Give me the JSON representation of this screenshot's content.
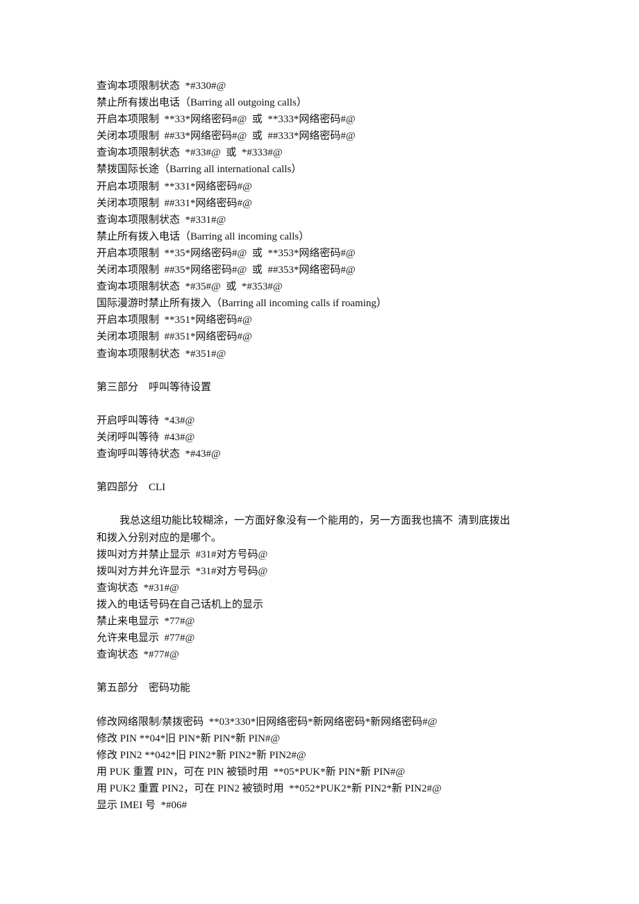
{
  "lines": [
    {
      "text": "查询本项限制状态  *#330#@"
    },
    {
      "text": "禁止所有拨出电话（Barring all outgoing calls）"
    },
    {
      "text": "开启本项限制  **33*网络密码#@  或  **333*网络密码#@"
    },
    {
      "text": "关闭本项限制  ##33*网络密码#@  或  ##333*网络密码#@"
    },
    {
      "text": "查询本项限制状态  *#33#@  或  *#333#@"
    },
    {
      "text": "禁拨国际长途（Barring all international calls）"
    },
    {
      "text": "开启本项限制  **331*网络密码#@"
    },
    {
      "text": "关闭本项限制  ##331*网络密码#@"
    },
    {
      "text": "查询本项限制状态  *#331#@"
    },
    {
      "text": "禁止所有拨入电话（Barring all incoming calls）"
    },
    {
      "text": "开启本项限制  **35*网络密码#@  或  **353*网络密码#@"
    },
    {
      "text": "关闭本项限制  ##35*网络密码#@  或  ##353*网络密码#@"
    },
    {
      "text": "查询本项限制状态  *#35#@  或  *#353#@"
    },
    {
      "text": "国际漫游时禁止所有拨入（Barring all incoming calls if roaming）"
    },
    {
      "text": "开启本项限制  **351*网络密码#@"
    },
    {
      "text": "关闭本项限制  ##351*网络密码#@"
    },
    {
      "text": "查询本项限制状态  *#351#@"
    },
    {
      "text": ""
    },
    {
      "text": "第三部分    呼叫等待设置",
      "heading": true
    },
    {
      "text": ""
    },
    {
      "text": "开启呼叫等待  *43#@"
    },
    {
      "text": "关闭呼叫等待  #43#@"
    },
    {
      "text": "查询呼叫等待状态  *#43#@"
    },
    {
      "text": ""
    },
    {
      "text": "第四部分    CLI",
      "heading": true
    },
    {
      "text": ""
    },
    {
      "text": "我总这组功能比较糊涂，一方面好象没有一个能用的，另一方面我也搞不  清到底拨出",
      "indent": true
    },
    {
      "text": "和拨入分别对应的是哪个。"
    },
    {
      "text": "拨叫对方并禁止显示  #31#对方号码@"
    },
    {
      "text": "拨叫对方并允许显示  *31#对方号码@"
    },
    {
      "text": "查询状态  *#31#@"
    },
    {
      "text": "拨入的电话号码在自己话机上的显示"
    },
    {
      "text": "禁止来电显示  *77#@"
    },
    {
      "text": "允许来电显示  #77#@"
    },
    {
      "text": "查询状态  *#77#@"
    },
    {
      "text": ""
    },
    {
      "text": "第五部分    密码功能",
      "heading": true
    },
    {
      "text": ""
    },
    {
      "text": "修改网络限制/禁拨密码  **03*330*旧网络密码*新网络密码*新网络密码#@"
    },
    {
      "text": "修改 PIN **04*旧 PIN*新 PIN*新 PIN#@"
    },
    {
      "text": "修改 PIN2 **042*旧 PIN2*新 PIN2*新 PIN2#@"
    },
    {
      "text": "用 PUK 重置 PIN，可在 PIN 被锁时用  **05*PUK*新 PIN*新 PIN#@"
    },
    {
      "text": "用 PUK2 重置 PIN2，可在 PIN2 被锁时用  **052*PUK2*新 PIN2*新 PIN2#@"
    },
    {
      "text": "显示 IMEI 号  *#06#"
    }
  ]
}
